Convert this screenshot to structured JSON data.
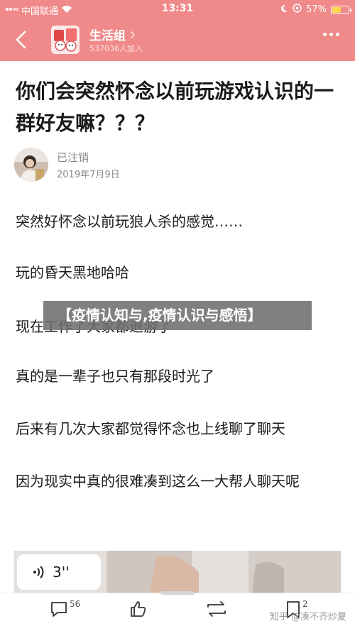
{
  "status_bar": {
    "carrier": "中国联通",
    "time": "13:31",
    "battery_percent": "57%",
    "battery_level": 0.57,
    "icons": [
      "signal-icon",
      "wifi-icon",
      "moon-icon",
      "location-icon",
      "battery-icon"
    ]
  },
  "nav": {
    "group_name": "生活组",
    "group_meta": "537036人加入"
  },
  "post": {
    "title": "你们会突然怀念以前玩游戏认识的一群好友嘛？？？",
    "author": "已注销",
    "date": "2019年7月9日",
    "paragraphs": [
      "突然好怀念以前玩狼人杀的感觉……",
      "玩的昏天黑地哈哈",
      "现在工作了大家都退游了",
      "真的是一辈子也只有那段时光了",
      "后来有几次大家都觉得怀念也上线聊了聊天",
      "因为现实中真的很难凑到这么一大帮人聊天呢"
    ]
  },
  "banner": {
    "text": "【疫情认知与,疫情认识与感悟】"
  },
  "media": {
    "voice_duration": "3''"
  },
  "bottom_bar": {
    "comment_count": "56",
    "repost_count": "2",
    "watermark": "知乎 @凑不齐纱夏"
  },
  "colors": {
    "header": "#f08a8a",
    "text": "#1a1a1a",
    "muted": "#8a8a8a"
  }
}
